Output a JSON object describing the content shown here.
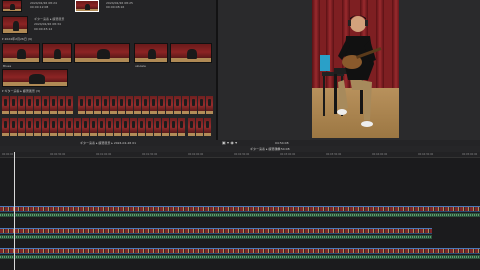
{
  "browser": {
    "top_clips": [
      {
        "meta": [
          "2024/02/26 08:24",
          "00:00:12:08"
        ]
      },
      {
        "meta": [
          "2024/02/26 08:25",
          "00:00:08:16"
        ]
      }
    ],
    "mid_clip": {
      "meta": [
        "2024/02/26 08:30",
        "00:00:11:04"
      ]
    },
    "folder_label": "ギター演奏 ▸ 練習風景",
    "folder_meta": [
      "2024/02/26 08:34",
      "00:00:45:12"
    ],
    "section1_title": "▾ 2024年2月26日 (9)",
    "row1_labels": [
      "Blues",
      "",
      "",
      "",
      "ukulele",
      ""
    ],
    "section2_title": "▾ ギター演奏 ▸ 練習風景 (3)"
  },
  "viewer": {
    "timecode": "28:00",
    "play_icon": "▶"
  },
  "toolbar": {
    "tools": "▣ ▾ ◉ ▾",
    "clip_name": "ギター演奏 ▸ 練習風景 ▸ 2024-02-26 01",
    "position": "04:54:08"
  },
  "timeline": {
    "header_title": "ギター演奏 ▸ 練習風景",
    "header_duration": "04:54:08",
    "ruler": [
      "00:00:00",
      "00:00:30:00",
      "00:01:00:00",
      "00:01:30:00",
      "00:02:00:00",
      "00:02:30:00",
      "00:03:00:00",
      "00:03:30:00",
      "00:04:00:00",
      "00:04:30:00",
      "00:05:00:00"
    ]
  },
  "colors": {
    "accent": "#2a4a72",
    "audio": "#2c4f3b",
    "background": "#1b1b1d"
  }
}
